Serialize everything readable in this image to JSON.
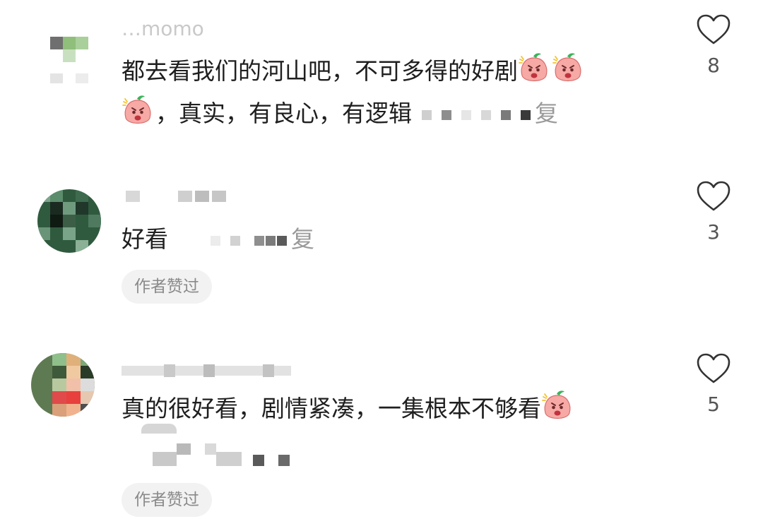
{
  "comments": [
    {
      "username": "…momo",
      "text_line1": "都去看我们的河山吧，不可多得的好剧",
      "text_line2": "，真实，有良心，有逻辑",
      "reply_tail": "复",
      "like_count": "8",
      "liked_by_author": null
    },
    {
      "username": "",
      "text": "好看",
      "reply_tail": "复",
      "like_count": "3",
      "liked_by_author": "作者赞过"
    },
    {
      "username": "",
      "text": "真的很好看，剧情紧凑，一集根本不够看",
      "like_count": "5",
      "liked_by_author": "作者赞过"
    }
  ],
  "icons": {
    "like": "heart-outline-icon",
    "emoji": "angry-peach-emoji"
  },
  "colors": {
    "text": "#1f1f1f",
    "muted": "#8a8a8a",
    "badge_bg": "#f2f2f2",
    "heart_stroke": "#333333"
  }
}
